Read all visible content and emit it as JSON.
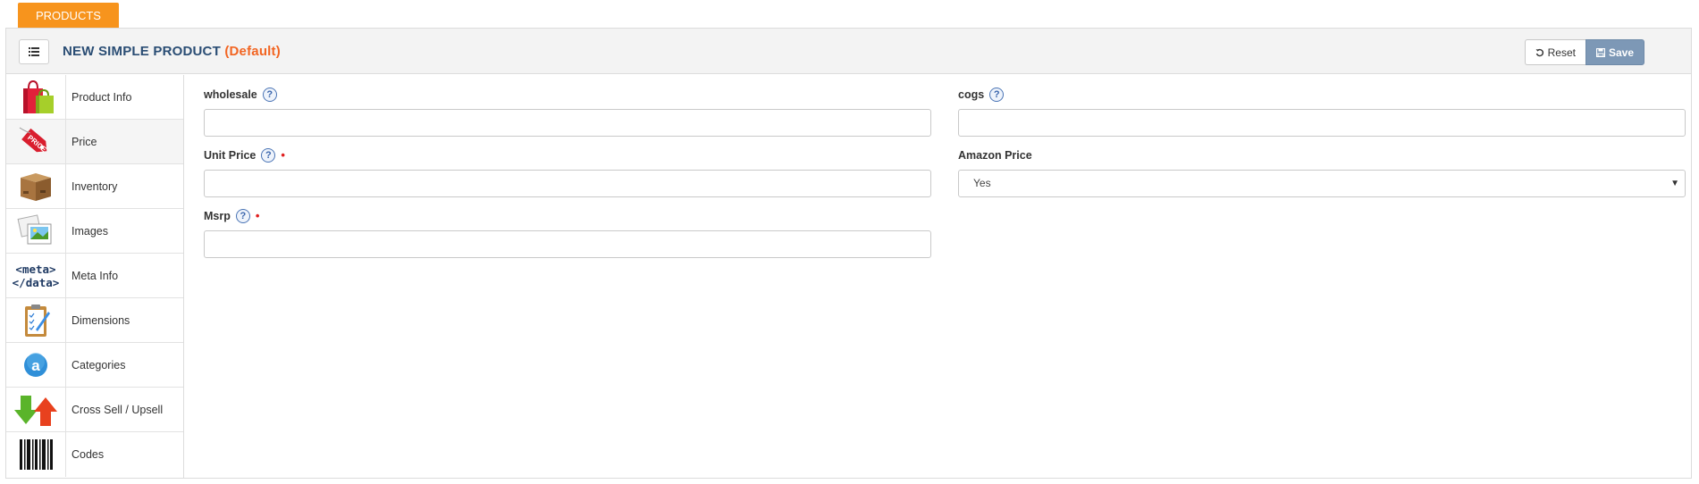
{
  "top_tab": {
    "label": "Products"
  },
  "header": {
    "title": "New Simple Product",
    "subtitle": "(Default)",
    "reset_label": "Reset",
    "save_label": "Save"
  },
  "sidebar": {
    "items": [
      {
        "label": "Product Info",
        "icon": "shopping-bags-icon"
      },
      {
        "label": "Price",
        "icon": "price-tag-icon"
      },
      {
        "label": "Inventory",
        "icon": "box-icon"
      },
      {
        "label": "Images",
        "icon": "images-icon"
      },
      {
        "label": "Meta Info",
        "icon": "meta-data-icon"
      },
      {
        "label": "Dimensions",
        "icon": "clipboard-icon"
      },
      {
        "label": "Categories",
        "icon": "category-a-icon"
      },
      {
        "label": "Cross Sell / Upsell",
        "icon": "arrows-up-down-icon"
      },
      {
        "label": "Codes",
        "icon": "barcode-icon"
      }
    ],
    "meta_icon_lines": [
      "<meta>",
      "</data>"
    ],
    "active_index": 1
  },
  "form": {
    "wholesale": {
      "label": "wholesale",
      "value": ""
    },
    "cogs": {
      "label": "cogs",
      "value": ""
    },
    "unit_price": {
      "label": "Unit Price",
      "value": ""
    },
    "amazon_price": {
      "label": "Amazon Price",
      "value": "Yes"
    },
    "msrp": {
      "label": "Msrp",
      "value": ""
    }
  },
  "colors": {
    "tab_orange": "#f7941d",
    "title_blue": "#2a4d74",
    "subtitle_orange": "#f26522",
    "save_blue": "#7d98b6",
    "required_red": "#e02020"
  }
}
